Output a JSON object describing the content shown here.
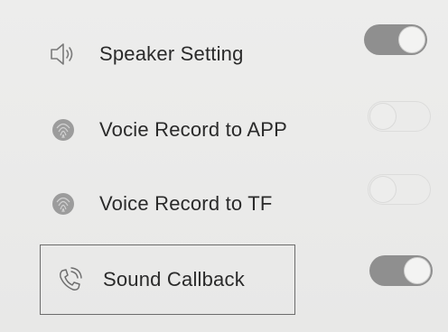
{
  "settings": {
    "items": [
      {
        "label": "Speaker Setting",
        "icon": "speaker-icon",
        "toggle": "on"
      },
      {
        "label": "Vocie Record to APP",
        "icon": "fingerprint-icon",
        "toggle": "off"
      },
      {
        "label": "Voice Record to TF",
        "icon": "fingerprint-icon",
        "toggle": "off"
      },
      {
        "label": "Sound Callback",
        "icon": "phone-callback-icon",
        "toggle": "on"
      }
    ]
  },
  "colors": {
    "background": "#ebebea",
    "text": "#2a2a2a",
    "toggle_on": "#8f8f8f",
    "toggle_off": "#ebebea"
  }
}
